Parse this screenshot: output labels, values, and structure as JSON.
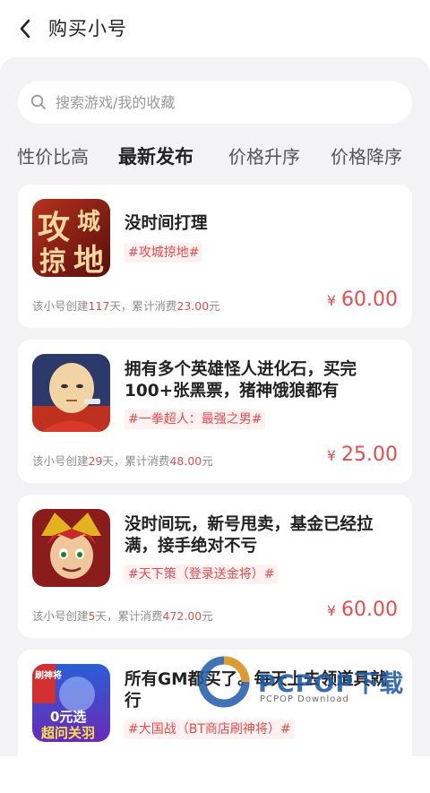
{
  "header": {
    "title": "购买小号"
  },
  "search": {
    "placeholder": "搜索游戏/我的收藏"
  },
  "tabs": [
    {
      "label": "性价比高",
      "active": false
    },
    {
      "label": "最新发布",
      "active": true
    },
    {
      "label": "价格升序",
      "active": false
    },
    {
      "label": "价格降序",
      "active": false
    }
  ],
  "listings": [
    {
      "thumb_icon": "game-icon-gongcheng-ludi",
      "thumb_text_a": "攻",
      "thumb_text_b": "城",
      "thumb_text_c": "掠",
      "thumb_text_d": "地",
      "title": "没时间打理",
      "tag": "#攻城掠地#",
      "meta_prefix": "该小号创建",
      "days": "117",
      "meta_mid": "天，累计消费",
      "spent": "23.00",
      "meta_suffix": "元",
      "currency": "¥",
      "price": "60.00"
    },
    {
      "thumb_icon": "game-icon-one-punch-man",
      "title": "拥有多个英雄怪人进化石，买完100+张黑票，猪神饿狼都有",
      "tag": "#一拳超人：最强之男#",
      "meta_prefix": "该小号创建",
      "days": "29",
      "meta_mid": "天，累计消费",
      "spent": "48.00",
      "meta_suffix": "元",
      "currency": "¥",
      "price": "25.00"
    },
    {
      "thumb_icon": "game-icon-tianxiace",
      "title": "没时间玩，新号甩卖，基金已经拉满，接手绝对不亏",
      "tag": "#天下策（登录送金将）#",
      "meta_prefix": "该小号创建",
      "days": "5",
      "meta_mid": "天，累计消费",
      "spent": "472.00",
      "meta_suffix": "元",
      "currency": "¥",
      "price": "60.00"
    },
    {
      "thumb_icon": "game-icon-daguozhan",
      "thumb_badge": "刷神将",
      "thumb_banner": "0元选",
      "thumb_banner2": "超问关羽",
      "title": "所有GM都买了。每天上去领道具就行",
      "tag": "#大国战（BT商店刷神将）#"
    }
  ],
  "watermark": {
    "name": "PCPOP下载",
    "sub": "PCPOP Download"
  },
  "colors": {
    "accent": "#e24d4d",
    "tag_bg": "#fff1f1",
    "panel_bg": "#f3f3f5"
  }
}
